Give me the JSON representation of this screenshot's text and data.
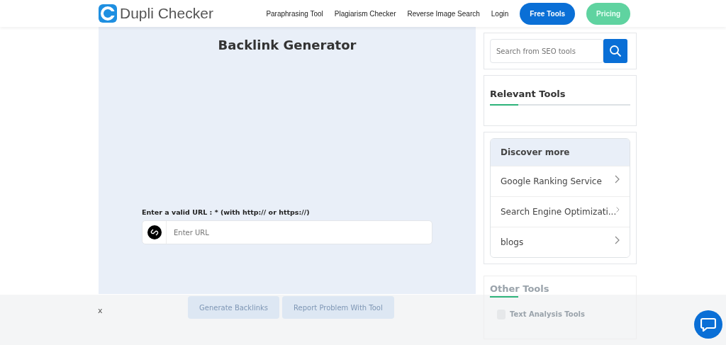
{
  "header": {
    "logo": "Dupli Checker",
    "nav": [
      {
        "label": "Paraphrasing Tool",
        "kind": "link"
      },
      {
        "label": "Plagiarism Checker",
        "kind": "link"
      },
      {
        "label": "Reverse Image Search",
        "kind": "link"
      },
      {
        "label": "Login",
        "kind": "link"
      },
      {
        "label": "Free Tools",
        "kind": "primary"
      },
      {
        "label": "Pricing",
        "kind": "secondary"
      }
    ]
  },
  "main": {
    "title": "Backlink Generator",
    "url_label": "Enter a valid URL : * (with http:// or https://)",
    "url_placeholder": "Enter URL",
    "buttons": [
      "Generate Backlinks",
      "Report Problem With Tool"
    ]
  },
  "sidebar": {
    "search_placeholder": "Search from SEO tools",
    "relevant_title": "Relevant Tools",
    "discover_title": "Discover more",
    "discover_items": [
      "Google Ranking Service",
      "Search Engine Optimizati...",
      "blogs"
    ],
    "other_title": "Other Tools",
    "other_items": [
      "Text Analysis Tools"
    ]
  },
  "ad_bar": {
    "close": "x"
  }
}
